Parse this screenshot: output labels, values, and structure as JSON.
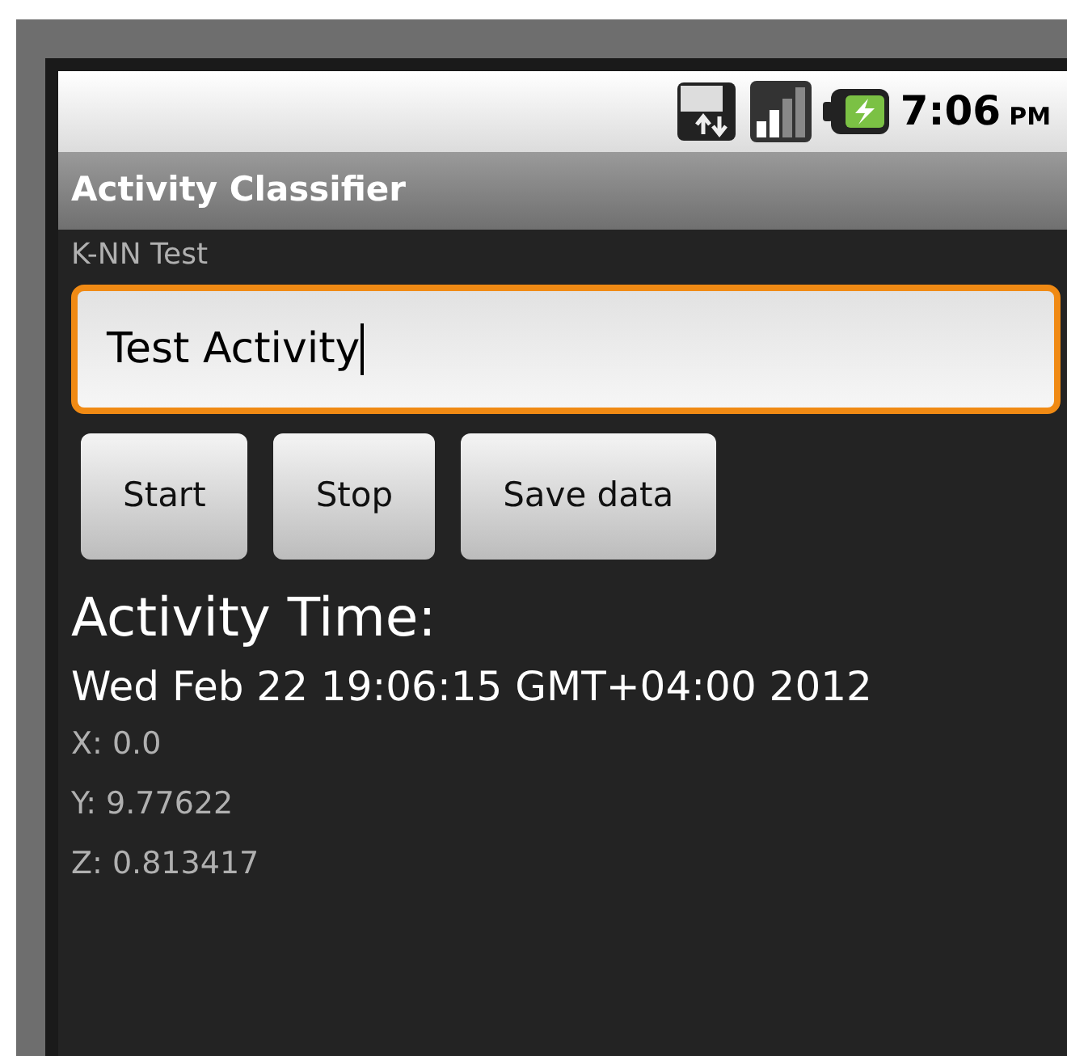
{
  "status_bar": {
    "time": "7:06",
    "meridiem": "PM"
  },
  "title_bar": {
    "title": "Activity Classifier"
  },
  "label": "K-NN Test",
  "field": {
    "value": "Test Activity",
    "focused": true
  },
  "buttons": [
    "Start",
    "Stop",
    "Save data"
  ],
  "heading": "Activity Time:",
  "timestamp": "Wed Feb 22 19:06:15 GMT+04:00 2012",
  "readings": [
    "X: 0.0",
    "Y: 9.77622",
    "Z: 0.813417"
  ]
}
